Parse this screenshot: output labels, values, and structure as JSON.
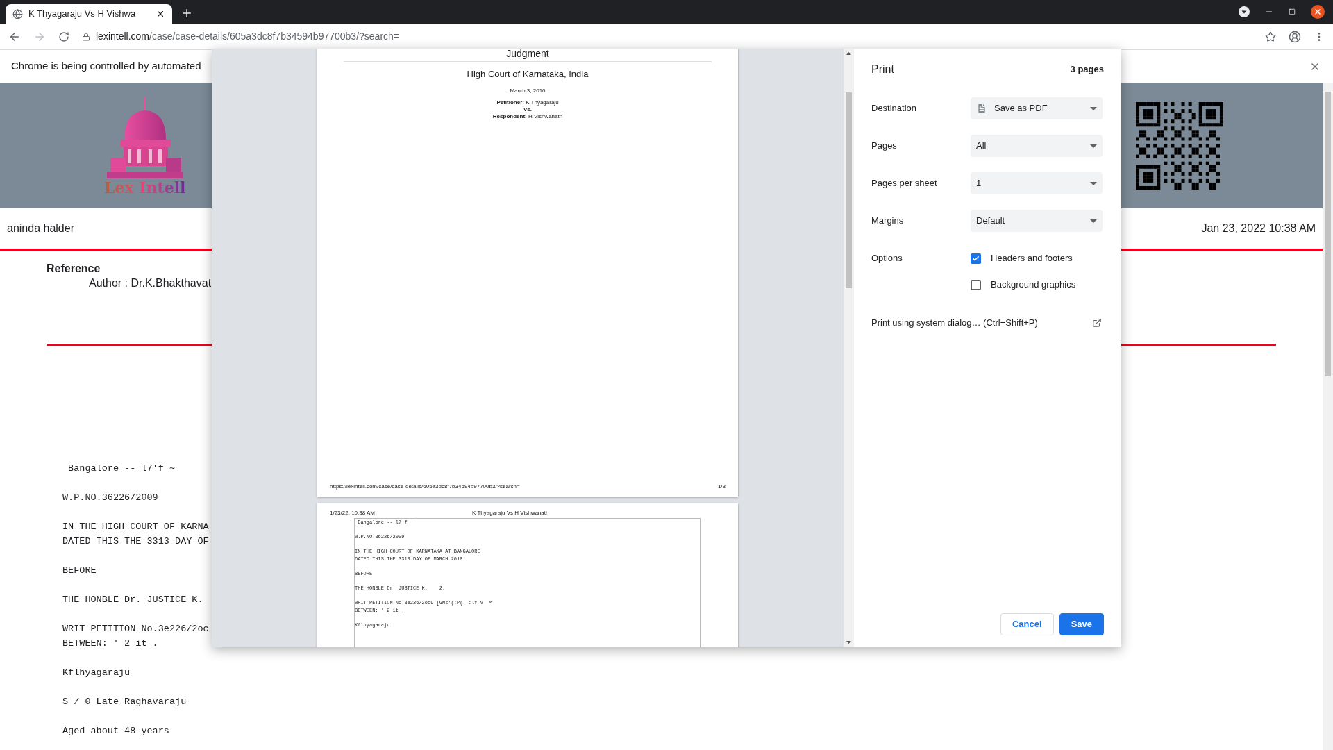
{
  "browser": {
    "tabs": [
      {
        "title": "K Thyagaraju Vs H Vishwa",
        "selected": true
      }
    ],
    "url_host": "lexintell.com",
    "url_path": "/case/case-details/605a3dc8f7b34594b97700b3/?search="
  },
  "infobar": {
    "message": "Chrome is being controlled by automated"
  },
  "page": {
    "logo_text": "Lex Intell",
    "user": "aninda halder",
    "timestamp": "Jan 23, 2022 10:38 AM",
    "reference_heading": "Reference",
    "author": "Author : Dr.K.Bhakthavat",
    "body_paragraphs": [
      [
        " Bangalore_--_l7'f ~"
      ],
      [
        "W.P.NO.36226/2009"
      ],
      [
        "IN THE HIGH COURT OF KARNA",
        "DATED THIS THE 3313 DAY OF"
      ],
      [
        "BEFORE"
      ],
      [
        "THE HONBLE Dr. JUSTICE K."
      ],
      [
        "WRIT PETITION No.3e226/2oc",
        "BETWEEN: ' 2 it ."
      ],
      [
        "Kflhyagaraju"
      ],
      [
        "S / 0 Late Raghavaraju"
      ],
      [
        "Aged about 48 years"
      ]
    ]
  },
  "print_dialog": {
    "title": "Print",
    "page_count": "3 pages",
    "settings": [
      {
        "label": "Destination",
        "kind": "destination",
        "value": "Save as PDF"
      },
      {
        "label": "Pages",
        "kind": "select",
        "value": "All"
      },
      {
        "label": "Pages per sheet",
        "kind": "select",
        "value": "1"
      },
      {
        "label": "Margins",
        "kind": "select",
        "value": "Default"
      }
    ],
    "options_label": "Options",
    "options": [
      {
        "label": "Headers and footers",
        "checked": true
      },
      {
        "label": "Background graphics",
        "checked": false
      }
    ],
    "system_dialog_link": "Print using system dialog… (Ctrl+Shift+P)",
    "buttons": [
      {
        "label": "Cancel",
        "kind": "secondary"
      },
      {
        "label": "Save",
        "kind": "primary"
      }
    ],
    "preview": {
      "first_page": {
        "heading": "Judgment",
        "court": "High Court of Karnataka, India",
        "date": "March 3, 2010",
        "petitioner": "**Petitioner:** K Thyagaraju",
        "versus": "Vs.",
        "respondent": "**Respondent:** H Vishwanath",
        "footer_url": "https://lexintell.com/case/case-details/605a3dc8f7b34594b97700b3/?search=",
        "footer_page": "1/3"
      },
      "second_page": {
        "header_date": "1/23/22, 10:38 AM",
        "header_title": "K Thyagaraju Vs H Vishwanath",
        "paragraphs": [
          [
            " Bangalore_--_l7'f ~"
          ],
          [
            "W.P.NO.36226/2009"
          ],
          [
            "IN THE HIGH COURT OF KARNATAKA AT BANGALORE",
            "DATED THIS THE 3313 DAY OF MARCH 2010"
          ],
          [
            "BEFORE"
          ],
          [
            "THE HONBLE Dr. JUSTICE K.    2."
          ],
          [
            "WRIT PETITION No.3e226/2oo9 [GMs'(:P(--:lf V  «",
            "BETWEEN: ' 2 it ."
          ],
          [
            "Kflhyagaraju"
          ]
        ]
      }
    }
  }
}
